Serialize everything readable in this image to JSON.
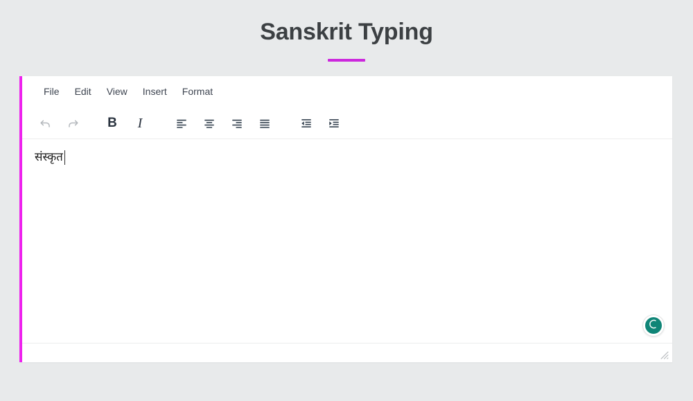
{
  "page": {
    "title": "Sanskrit Typing",
    "background_color": "#e8eaeb",
    "title_color": "#3c4043",
    "accent_color": "#cc28dd"
  },
  "editor": {
    "accent_bar_color": "#ee22ee",
    "menubar": {
      "items": [
        {
          "label": "File",
          "name": "menu-item-file"
        },
        {
          "label": "Edit",
          "name": "menu-item-edit"
        },
        {
          "label": "View",
          "name": "menu-item-view"
        },
        {
          "label": "Insert",
          "name": "menu-item-insert"
        },
        {
          "label": "Format",
          "name": "menu-item-format"
        }
      ]
    },
    "toolbar": {
      "undo": {
        "icon": "undo-icon",
        "label": "Undo",
        "enabled": false
      },
      "redo": {
        "icon": "redo-icon",
        "label": "Redo",
        "enabled": false
      },
      "bold": {
        "icon": "bold-icon",
        "label": "B"
      },
      "italic": {
        "icon": "italic-icon",
        "label": "I"
      },
      "align_left": {
        "icon": "align-left-icon",
        "label": "Align left"
      },
      "align_center": {
        "icon": "align-center-icon",
        "label": "Align center"
      },
      "align_right": {
        "icon": "align-right-icon",
        "label": "Align right"
      },
      "align_justify": {
        "icon": "align-justify-icon",
        "label": "Justify"
      },
      "outdent": {
        "icon": "outdent-icon",
        "label": "Decrease indent"
      },
      "indent": {
        "icon": "indent-icon",
        "label": "Increase indent"
      }
    },
    "content": {
      "text": "संस्कृत",
      "caret_visible": true
    },
    "badge": {
      "icon": "spinner-circle-icon",
      "color": "#0f8577"
    },
    "statusbar": {
      "resize_grip": "resize-grip-icon"
    }
  }
}
